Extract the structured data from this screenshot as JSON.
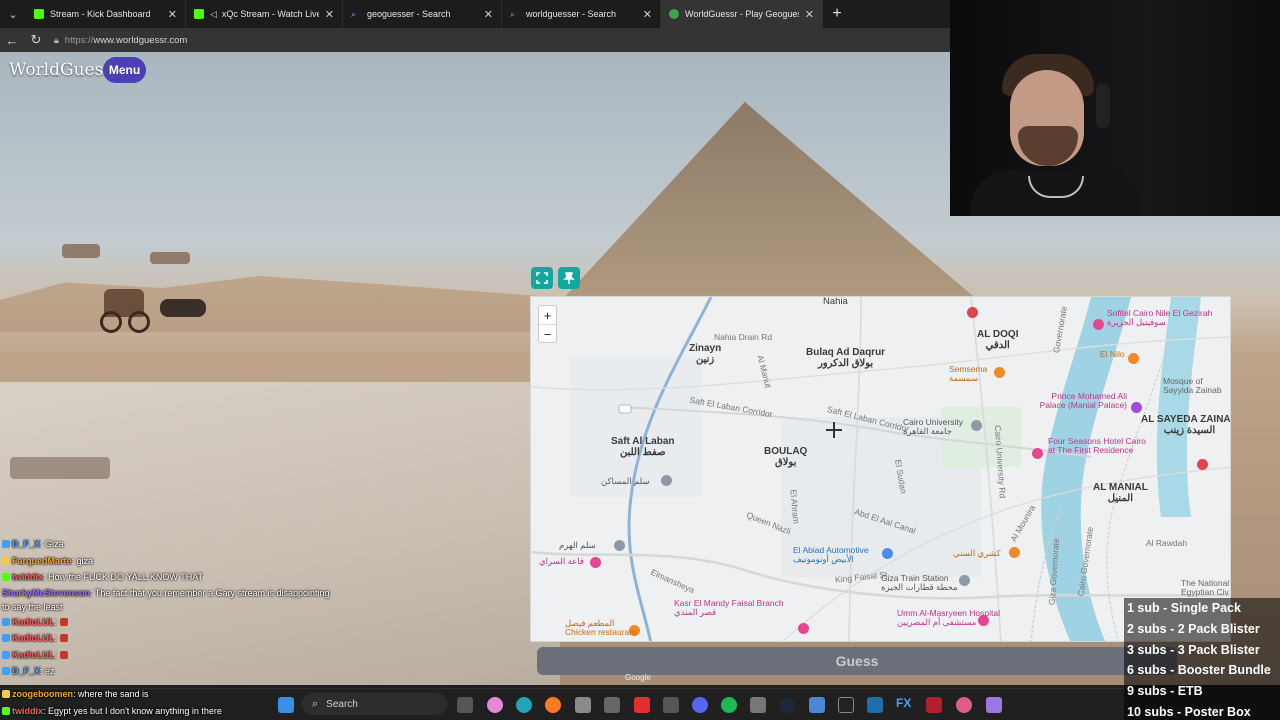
{
  "browser": {
    "tabs": [
      {
        "title": "Stream - Kick Dashboard",
        "favicon_color": "#53fc18",
        "active": false
      },
      {
        "title": "xQc Stream - Watch Live on Ki",
        "favicon_color": "#53fc18",
        "active": false
      },
      {
        "title": "geoguesser - Search",
        "favicon_color": "#3b82f6",
        "active": false
      },
      {
        "title": "worldguesser - Search",
        "favicon_color": "#3b82f6",
        "active": false
      },
      {
        "title": "WorldGuessr - Play Geoguessr for",
        "favicon_color": "#3fa34d",
        "active": true
      }
    ],
    "close_glyph": "✕",
    "newtab_glyph": "+",
    "url_scheme": "https://",
    "url_host": "www.worldguessr.com"
  },
  "game": {
    "logo": "WorldGuessr",
    "menu_label": "Menu",
    "guess_label": "Guess",
    "map_attribution": "Google",
    "zoom_in": "+",
    "zoom_out": "−"
  },
  "map": {
    "areas": [
      {
        "name": "Nahia",
        "sub": ""
      },
      {
        "name": "Zinayn",
        "sub": "زنين"
      },
      {
        "name": "Bulaq Ad Daqrur",
        "sub": "بولاق الدكرور"
      },
      {
        "name": "Saft Al Laban",
        "sub": "صفط اللبن"
      },
      {
        "name": "BOULAQ",
        "sub": "بولاق"
      },
      {
        "name": "AL DOQI",
        "sub": "الدقي"
      },
      {
        "name": "AL SAYEDA ZAINAB",
        "sub": "السيدة زينب"
      },
      {
        "name": "AL MANIAL",
        "sub": "المنيل"
      }
    ],
    "roads": [
      "Nahia Drain Rd",
      "Al Mariut",
      "Saft El Laban Corridor",
      "Saft El Laban Corridor",
      "Queen Nazli",
      "El Ahram",
      "Abd El Aal Canal",
      "King Faisal St",
      "Elmansheya",
      "El Sudan",
      "Cairo University Rd",
      "Al Rawdah",
      "Cairo Governorate",
      "Giza Governorate",
      "Governorate",
      "Al Mounira"
    ],
    "pois": [
      {
        "name": "Sofitel Cairo Nile El Gezirah",
        "sub": "سوفيتيل الجزيرة",
        "kind": "pink"
      },
      {
        "name": "El Nilo",
        "sub": "",
        "kind": "orange"
      },
      {
        "name": "Semsema",
        "sub": "سمسمة",
        "kind": "orange"
      },
      {
        "name": "Prince Mohamed Ali Palace (Manial Palace)",
        "sub": "",
        "kind": "pink"
      },
      {
        "name": "Mosque of Sayyida Zainab",
        "sub": "",
        "kind": "gray"
      },
      {
        "name": "Cairo University",
        "sub": "جامعة القاهرة",
        "kind": "gray"
      },
      {
        "name": "Four Seasons Hotel Cairo at The First Residence",
        "sub": "",
        "kind": "pink"
      },
      {
        "name": "El Abiad Automotive",
        "sub": "الأبيض أوتوموتيف",
        "kind": "blue"
      },
      {
        "name": "Kasr El Mandy Faisal Branch",
        "sub": "قصر المندي",
        "kind": "pink"
      },
      {
        "name": "Giza Train Station",
        "sub": "محطة قطارات الجيزة",
        "kind": "gray"
      },
      {
        "name": "Umm Al-Masryeen Hospital",
        "sub": "مستشفى أم المصريين",
        "kind": "pink"
      },
      {
        "name": "Chicken restaurant",
        "sub": "المطعم فيصل",
        "kind": "orange"
      },
      {
        "name": "The National Egyptian Civ",
        "sub": "",
        "kind": "gray"
      },
      {
        "name": "كشري السني",
        "sub": "",
        "kind": "orange"
      },
      {
        "name": "سلم المساكن",
        "sub": "",
        "kind": "gray"
      },
      {
        "name": "سلم الهرم",
        "sub": "",
        "kind": "gray"
      },
      {
        "name": "قاعة السراي",
        "sub": "",
        "kind": "pink"
      }
    ]
  },
  "chat": [
    {
      "user": "D_F_X",
      "message": "Giza",
      "badge_color": "#3aa0ff",
      "user_color": "#4da3ff"
    },
    {
      "user": "FarquedMarte",
      "message": "giza",
      "badge_color": "#f2c94c",
      "user_color": "#f5a623"
    },
    {
      "user": "twiddix",
      "message": "How the FUCK DO YALL KNOW THAT",
      "badge_color": "#53fc18",
      "user_color": "#ff5a5a"
    },
    {
      "user": "SharkyMcStevenson",
      "message": "The fact that you remember a Gary stream is disappointing to say the least",
      "badge_color": "",
      "user_color": "#9b6bff"
    },
    {
      "user": "KadioLUL",
      "message": "",
      "badge_color": "#3aa0ff",
      "user_color": "#ff5a5a"
    },
    {
      "user": "KadioLUL",
      "message": "",
      "badge_color": "#3aa0ff",
      "user_color": "#ff5a5a"
    },
    {
      "user": "KadioLUL",
      "message": "",
      "badge_color": "#3aa0ff",
      "user_color": "#ff5a5a"
    },
    {
      "user": "D_F_X",
      "message": "ez",
      "badge_color": "#3aa0ff",
      "user_color": "#4da3ff"
    },
    {
      "user": "zoogeboomen",
      "message": "where the sand is",
      "badge_color": "#f2c94c",
      "user_color": "#f5a623"
    },
    {
      "user": "twiddix",
      "message": "Egypt yes but I don't know anything in there",
      "badge_color": "#53fc18",
      "user_color": "#ff5a5a"
    }
  ],
  "sub_goals": [
    "1 sub - Single Pack",
    "2 subs - 2 Pack Blister",
    "3 subs - 3 Pack Blister",
    "6 subs - Booster Bundle",
    "9 subs - ETB",
    "10 subs - Poster Box"
  ],
  "taskbar": {
    "search_label": "Search",
    "fx_label": "FX"
  }
}
